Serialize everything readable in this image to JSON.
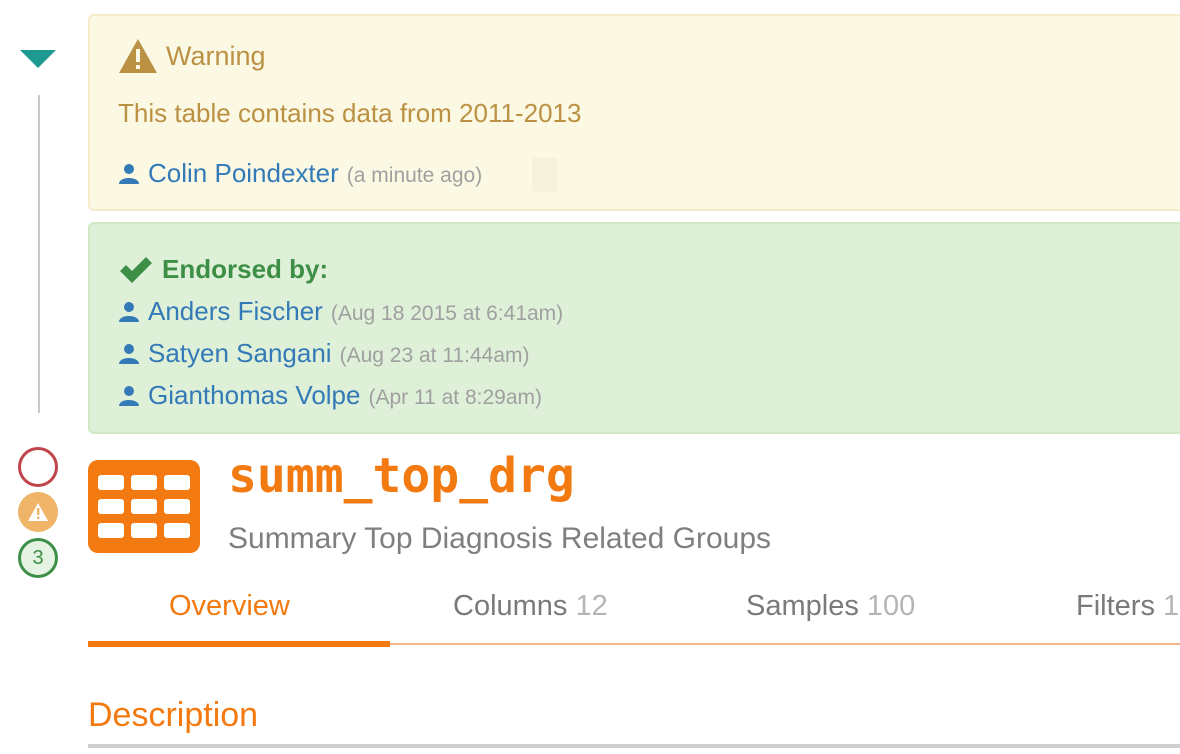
{
  "warning": {
    "title": "Warning",
    "message": "This table contains data from 2011-2013",
    "author": "Colin Poindexter",
    "time": "(a minute ago)",
    "color": "#bb9144"
  },
  "endorsements": {
    "title": "Endorsed by:",
    "color": "#3e8f46",
    "items": [
      {
        "name": "Anders Fischer",
        "time": "(Aug 18 2015 at 6:41am)"
      },
      {
        "name": "Satyen Sangani",
        "time": "(Aug 23 at 11:44am)"
      },
      {
        "name": "Gianthomas Volpe",
        "time": "(Apr 11 at 8:29am)"
      }
    ]
  },
  "rail": {
    "count_badge": "3",
    "icons": [
      "caret-down-icon",
      "empty-circle-icon",
      "warning-icon"
    ]
  },
  "table": {
    "name": "summ_top_drg",
    "description": "Summary Top Diagnosis Related Groups",
    "accent": "#f27a10"
  },
  "tabs": [
    {
      "label": "Overview",
      "count": ""
    },
    {
      "label": "Columns",
      "count": "12"
    },
    {
      "label": "Samples",
      "count": "100"
    },
    {
      "label": "Filters",
      "count": "1"
    }
  ],
  "section": {
    "title": "Description"
  }
}
